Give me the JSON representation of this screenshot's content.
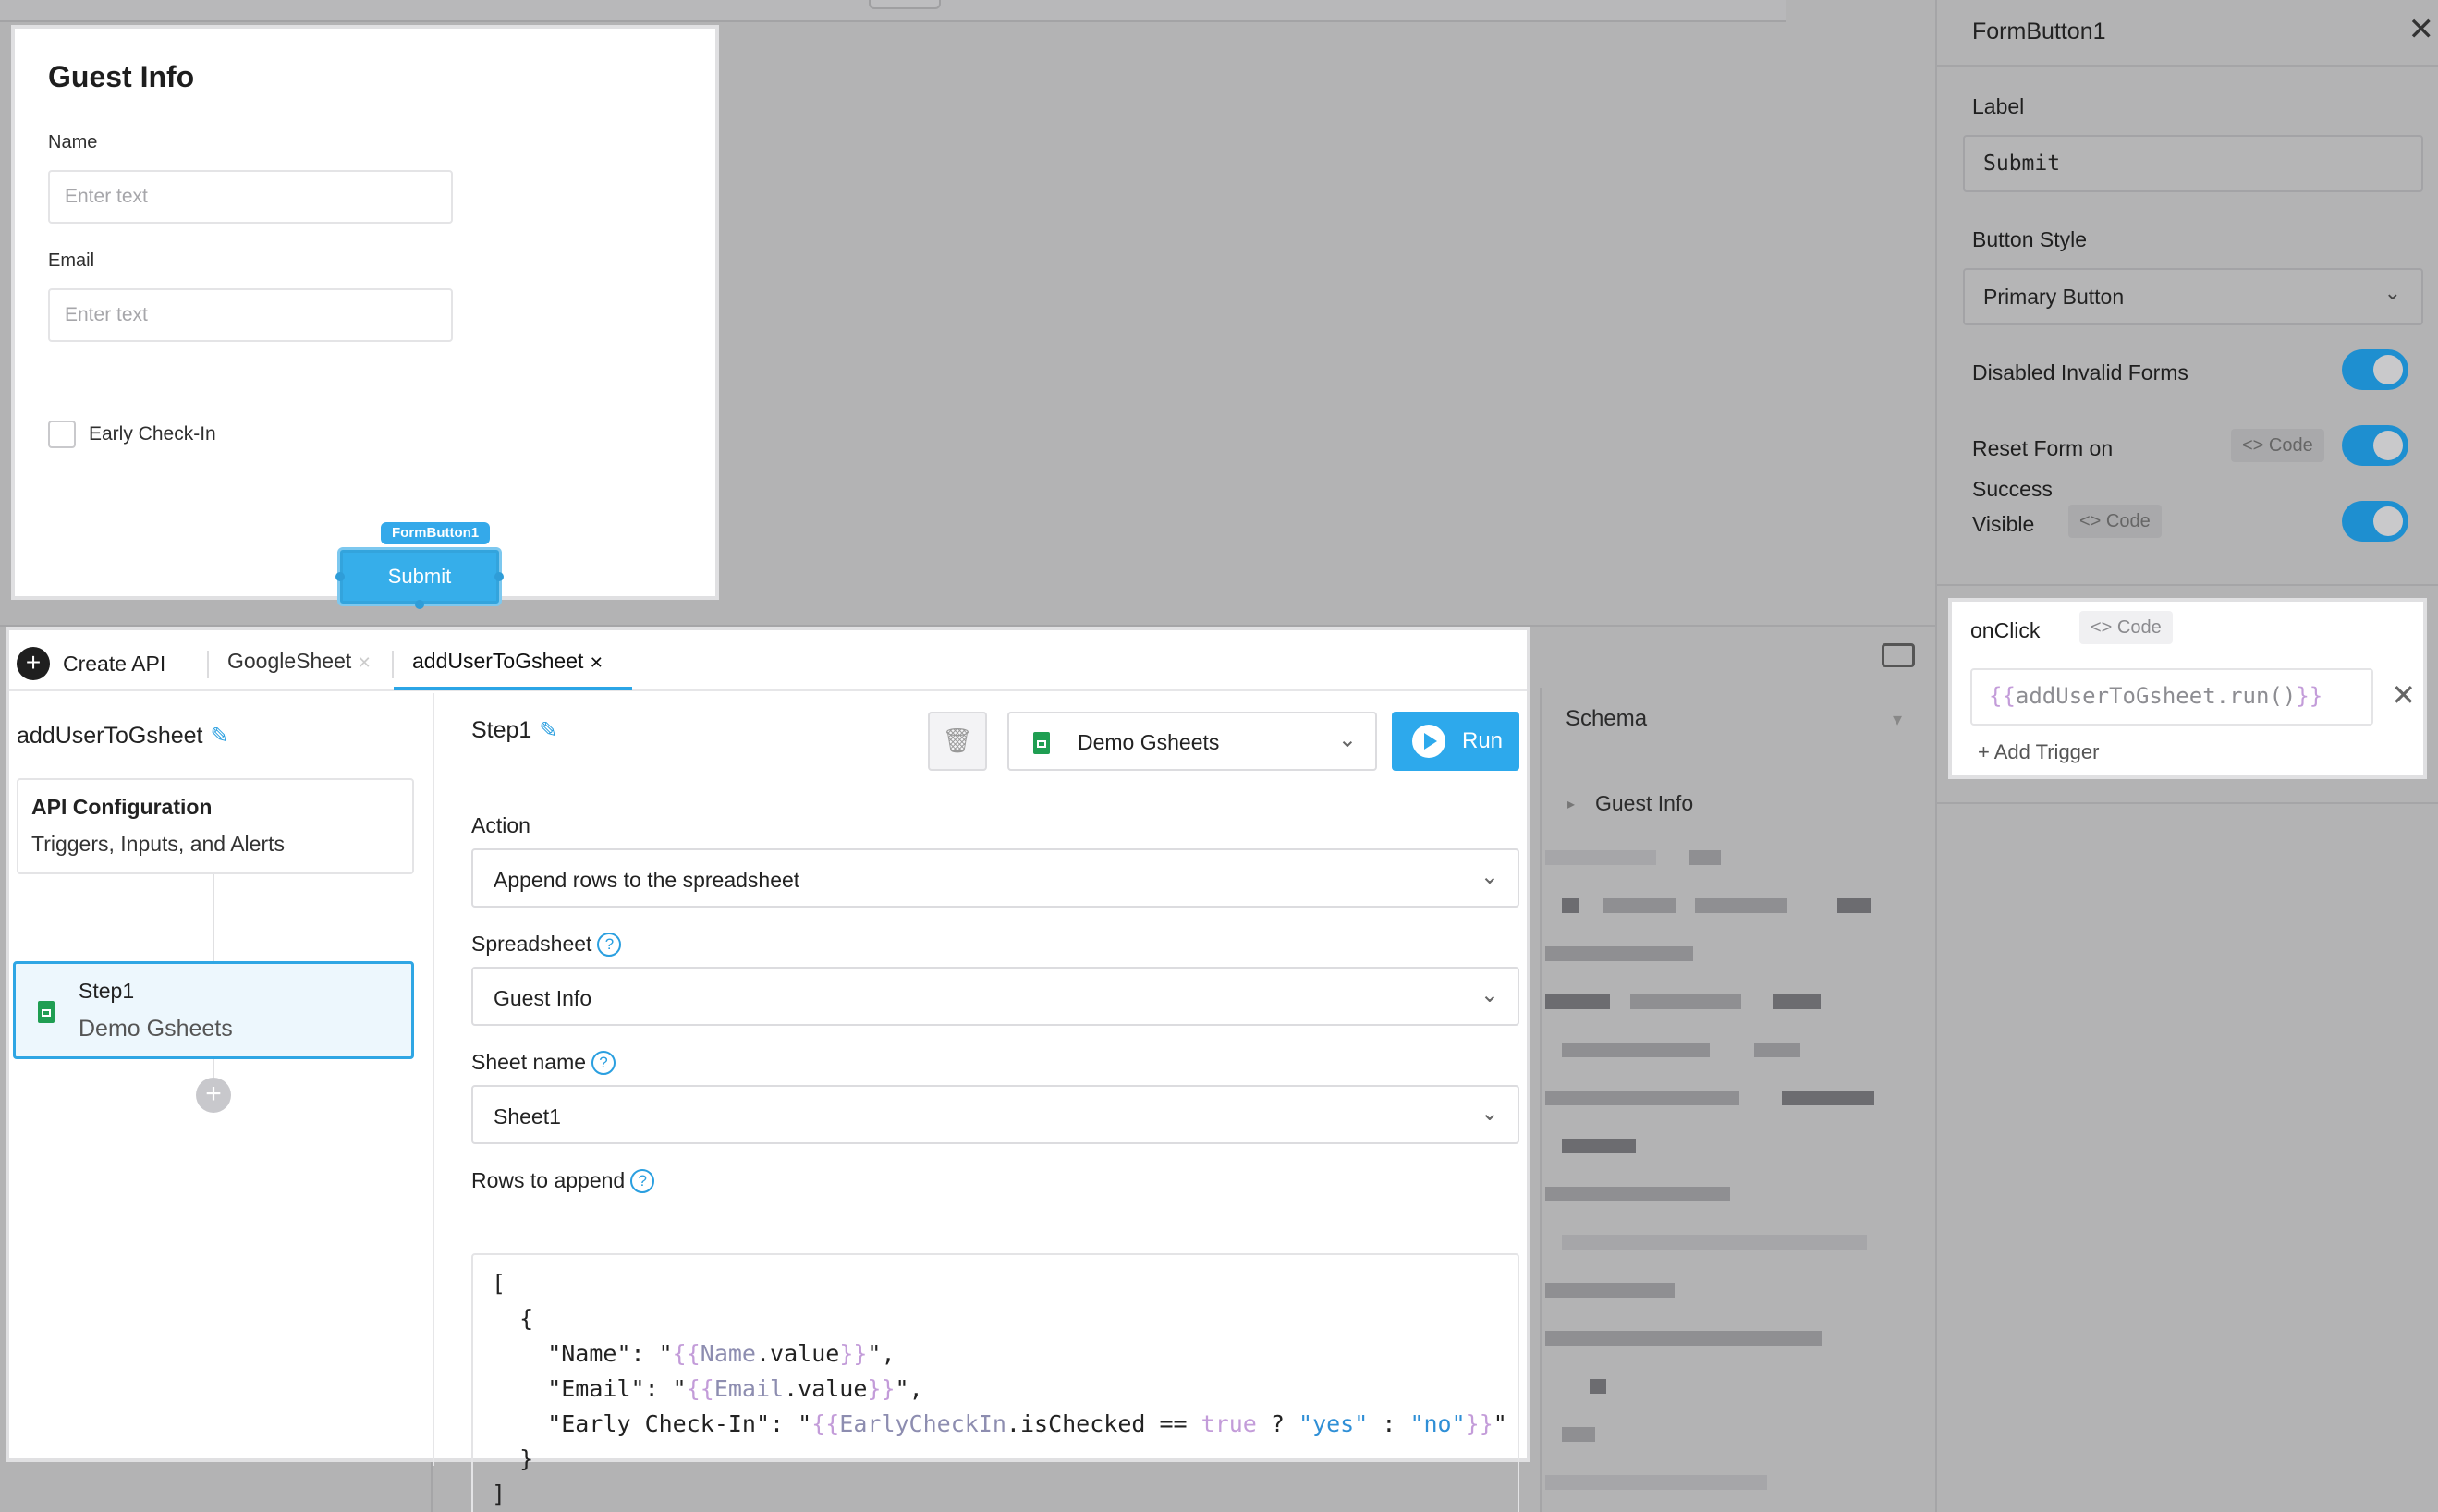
{
  "form": {
    "title": "Guest Info",
    "name_label": "Name",
    "name_placeholder": "Enter text",
    "email_label": "Email",
    "email_placeholder": "Enter text",
    "checkbox_label": "Early Check-In",
    "button_tag": "FormButton1",
    "submit_label": "Submit"
  },
  "panel": {
    "title": "FormButton1",
    "label_title": "Label",
    "label_value": "Submit",
    "style_title": "Button Style",
    "style_value": "Primary Button",
    "disabled_invalid": "Disabled Invalid Forms",
    "reset_form": "Reset Form on",
    "reset_form_2": "Success",
    "visible": "Visible",
    "code_badge": "Code",
    "onclick_title": "onClick",
    "onclick_open": "{{",
    "onclick_value": "addUserToGsheet.run()",
    "onclick_close": "}}",
    "add_trigger": "Add Trigger"
  },
  "api": {
    "create_label": "Create API",
    "tabs": [
      "GoogleSheet",
      "addUserToGsheet"
    ],
    "api_name": "addUserToGsheet",
    "config_title": "API Configuration",
    "config_sub": "Triggers, Inputs, and Alerts",
    "step_title": "Step1",
    "step_sub": "Demo Gsheets",
    "step_head": "Step1",
    "datasource": "Demo Gsheets",
    "run_label": "Run",
    "action_label": "Action",
    "action_value": "Append rows to the spreadsheet",
    "spreadsheet_label": "Spreadsheet",
    "spreadsheet_value": "Guest Info",
    "sheet_label": "Sheet name",
    "sheet_value": "Sheet1",
    "rows_label": "Rows to append"
  },
  "schema": {
    "title": "Schema",
    "item": "Guest Info"
  },
  "colors": {
    "accent": "#2da9ec",
    "sheets_green": "#1f9e52"
  }
}
